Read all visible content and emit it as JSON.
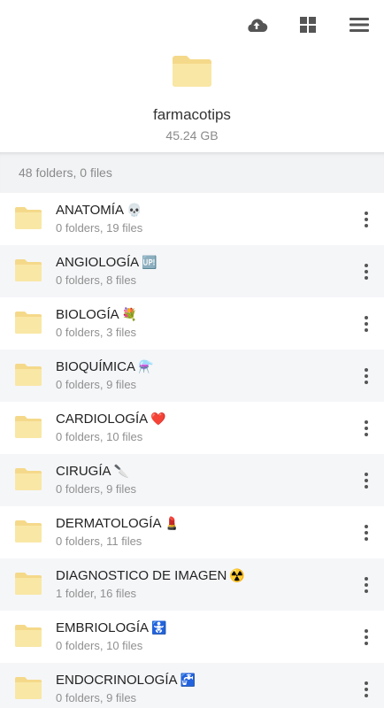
{
  "toolbar": {
    "icons": [
      "cloud-upload-icon",
      "grid-view-icon",
      "hamburger-menu-icon"
    ]
  },
  "folder": {
    "icon": "folder-icon",
    "name": "farmacotips",
    "size": "45.24 GB"
  },
  "summary": "48 folders, 0 files",
  "colors": {
    "folder_fill": "#f9e7a6",
    "folder_tab": "#f5d98a",
    "alt_row": "#f5f6f8"
  },
  "items": [
    {
      "title": "ANATOMÍA",
      "emoji": "💀",
      "subtitle": "0 folders, 19 files"
    },
    {
      "title": "ANGIOLOGÍA",
      "emoji": "🆙",
      "subtitle": "0 folders, 8 files"
    },
    {
      "title": "BIOLOGÍA",
      "emoji": "💐",
      "subtitle": "0 folders, 3 files"
    },
    {
      "title": "BIOQUÍMICA",
      "emoji": "⚗️",
      "subtitle": "0 folders, 9 files"
    },
    {
      "title": "CARDIOLOGÍA",
      "emoji": "❤️",
      "subtitle": "0 folders, 10 files"
    },
    {
      "title": "CIRUGÍA",
      "emoji": "🔪",
      "subtitle": "0 folders, 9 files"
    },
    {
      "title": "DERMATOLOGÍA",
      "emoji": "💄",
      "subtitle": "0 folders, 11 files"
    },
    {
      "title": "DIAGNOSTICO DE IMAGEN",
      "emoji": "☢️",
      "subtitle": "1 folder, 16 files"
    },
    {
      "title": "EMBRIOLOGÍA",
      "emoji": "🚼",
      "subtitle": "0 folders, 10 files"
    },
    {
      "title": "ENDOCRINOLOGÍA",
      "emoji": "🚰",
      "subtitle": "0 folders, 9 files"
    }
  ]
}
